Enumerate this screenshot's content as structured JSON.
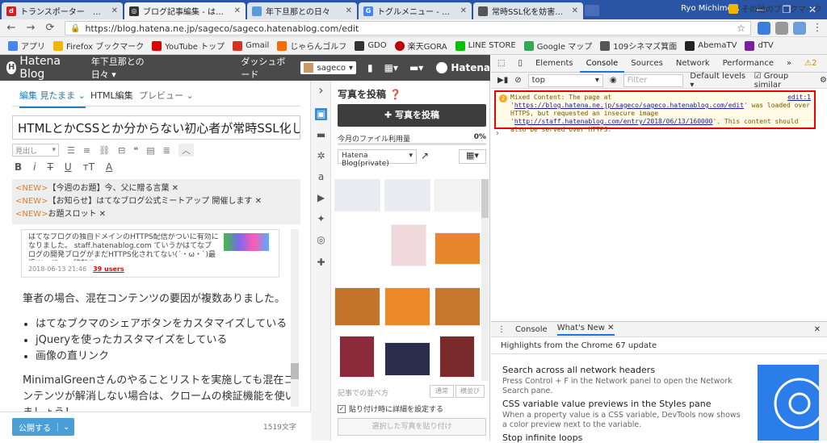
{
  "browser": {
    "tabs": [
      {
        "title": "トランスポーター　ザ・シリーズ",
        "fav_color": "#cc1f1f",
        "fav_text": "d"
      },
      {
        "title": "ブログ記事編集 - はてなブロ",
        "fav_color": "#333333",
        "fav_text": "◎"
      },
      {
        "title": "年下旦那との日々",
        "fav_color": "#5a9bd5",
        "fav_text": ""
      },
      {
        "title": "トグルメニュー - Google 検索",
        "fav_color": "#4285f4",
        "fav_text": "G"
      },
      {
        "title": "常時SSL化を妨害する混在",
        "fav_color": "#555555",
        "fav_text": ""
      }
    ],
    "profile_name": "Ryo Michimo...",
    "url": "https://blog.hatena.ne.jp/sageco/sageco.hatenablog.com/edit",
    "bookmarks": [
      "アプリ",
      "Firefox ブックマーク",
      "YouTube トップ",
      "Gmail",
      "じゃらんゴルフ",
      "GDO",
      "楽天GORA",
      "LINE STORE",
      "Google マップ",
      "109シネマズ箕面",
      "AbemaTV",
      "dTV"
    ],
    "bookmark_colors": [
      "#4285f4",
      "#f4b400",
      "#e00000",
      "#d93025",
      "#ff6a00",
      "#333333",
      "#bf0000",
      "#00c300",
      "#34a853",
      "#555555",
      "#222222",
      "#7b1fa2"
    ],
    "other_bookmarks": "その他のブックマーク"
  },
  "hatena": {
    "logo": "Hatena Blog",
    "blog_name": "年下旦那との日々",
    "dashboard": "ダッシュボード",
    "user": "sageco",
    "brand": "Hatena"
  },
  "editor": {
    "tab_edit": "編集 見たまま",
    "tab_html": "HTML編集",
    "tab_preview": "プレビュー",
    "title": "HTMLとかCSSとか分からない初心者が常時SSL化してみた",
    "heading_select": "見出し",
    "notices": [
      {
        "tag": "<NEW>",
        "text": "【今週のお題】今、父に贈る言葉"
      },
      {
        "tag": "<NEW>",
        "text": "【お知らせ】はてなブログ公式ミートアップ 開催します"
      },
      {
        "tag": "<NEW>",
        "text": "お題スロット"
      }
    ],
    "embed_text": "はてなブログの独自ドメインのHTTPS配信がついに有効になりました。 staff.hatenablog.com ていうかはてなブログの開発ブログがまだHTTPS化されてない(´・ω・`)最近WordPress移転す...",
    "embed_date": "2018-06-13 21:46",
    "embed_users": "39 users",
    "paragraph1": "筆者の場合、混在コンテンツの要因が複数ありました。",
    "bullets": [
      "はてなブクマのシェアボタンをカスタマイズしている",
      "jQueryを使ったカスタマイズをしている",
      "画像の直リンク"
    ],
    "paragraph2": "MinimalGreenさんのやることリストを実施しても混在コンテンツが解消しない場合は、クロームの検証機能を使いましょう！",
    "publish": "公開する",
    "char_count": "1519文字"
  },
  "photos": {
    "title": "写真を投稿",
    "post_button": "写真を投稿",
    "usage_label": "今月のファイル利用量",
    "usage_pct": "0%",
    "album": "Hatena Blog(private)",
    "order_label": "記事での並べ方",
    "order_btn1": "通常",
    "order_btn2": "横並び",
    "checkbox_label": "貼り付け時に詳細を設定する",
    "paste_button": "選択した写真を貼り付け"
  },
  "devtools": {
    "tabs": [
      "Elements",
      "Console",
      "Sources",
      "Network",
      "Performance"
    ],
    "active_tab": "Console",
    "warn_count": "2",
    "context": "top",
    "filter_placeholder": "Filter",
    "levels": "Default levels",
    "group_similar": "Group similar",
    "msg_pre": "Mixed Content: The page at '",
    "msg_link1": "https://blog.hatena.ne.jp/sageco/sageco.hatenablog.com/edit",
    "msg_mid": "' was loaded over HTTPS, but requested an insecure image '",
    "msg_link2": "http://staff.hatenablog.com/entry/2018/06/13/160000",
    "msg_post": "'. This content should also be served over HTTPS.",
    "msg_source": "edit:1",
    "drawer_tabs": [
      "Console",
      "What's New"
    ],
    "highlights": "Highlights from the Chrome 67 update",
    "news": [
      {
        "head": "Search across all network headers",
        "desc": "Press Control + F in the Network panel to open the Network Search pane."
      },
      {
        "head": "CSS variable value previews in the Styles pane",
        "desc": "When a property value is a CSS variable, DevTools now shows a color preview next to the variable."
      },
      {
        "head": "Stop infinite loops",
        "desc": ""
      }
    ]
  }
}
